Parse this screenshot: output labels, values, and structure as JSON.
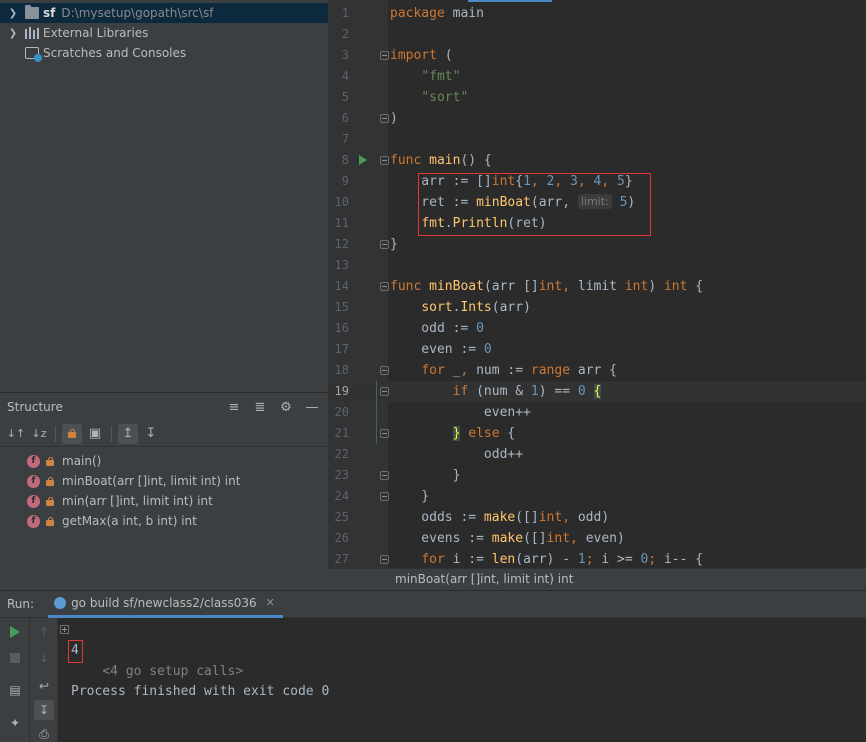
{
  "project": {
    "root": {
      "name": "sf",
      "path": "D:\\mysetup\\gopath\\src\\sf"
    },
    "items": [
      {
        "label": "External Libraries"
      },
      {
        "label": "Scratches and Consoles"
      }
    ]
  },
  "structure": {
    "title": "Structure",
    "members": [
      {
        "badge": "f",
        "label": "main()"
      },
      {
        "badge": "f",
        "label": "minBoat(arr []int, limit int) int"
      },
      {
        "badge": "f",
        "label": "min(arr []int, limit int) int"
      },
      {
        "badge": "f",
        "label": "getMax(a int, b int) int"
      }
    ]
  },
  "editor": {
    "current_line": 19,
    "lines": [
      {
        "n": "1",
        "tokens": [
          [
            "kw",
            "package"
          ],
          [
            "plain",
            " main"
          ]
        ]
      },
      {
        "n": "2",
        "tokens": []
      },
      {
        "n": "3",
        "fold": true,
        "tokens": [
          [
            "kw",
            "import"
          ],
          [
            "plain",
            " ("
          ]
        ]
      },
      {
        "n": "4",
        "tokens": [
          [
            "plain",
            "    "
          ],
          [
            "str",
            "\"fmt\""
          ]
        ]
      },
      {
        "n": "5",
        "tokens": [
          [
            "plain",
            "    "
          ],
          [
            "str",
            "\"sort\""
          ]
        ]
      },
      {
        "n": "6",
        "fold": true,
        "tokens": [
          [
            "plain",
            ")"
          ]
        ]
      },
      {
        "n": "7",
        "tokens": []
      },
      {
        "n": "8",
        "fold": true,
        "run": true,
        "tokens": [
          [
            "kw",
            "func"
          ],
          [
            "plain",
            " "
          ],
          [
            "fn",
            "main"
          ],
          [
            "plain",
            "() {"
          ]
        ]
      },
      {
        "n": "9",
        "tokens": [
          [
            "plain",
            "    arr := []"
          ],
          [
            "typ",
            "int"
          ],
          [
            "plain",
            "{"
          ],
          [
            "num",
            "1"
          ],
          [
            "kw",
            ", "
          ],
          [
            "num",
            "2"
          ],
          [
            "kw",
            ", "
          ],
          [
            "num",
            "3"
          ],
          [
            "kw",
            ", "
          ],
          [
            "num",
            "4"
          ],
          [
            "kw",
            ", "
          ],
          [
            "num",
            "5"
          ],
          [
            "plain",
            "}"
          ]
        ]
      },
      {
        "n": "10",
        "tokens": [
          [
            "plain",
            "    ret := "
          ],
          [
            "fn",
            "minBoat"
          ],
          [
            "plain",
            "(arr, "
          ],
          [
            "hint",
            "limit:"
          ],
          [
            "plain",
            " "
          ],
          [
            "num",
            "5"
          ],
          [
            "plain",
            ")"
          ]
        ]
      },
      {
        "n": "11",
        "tokens": [
          [
            "plain",
            "    "
          ],
          [
            "fn",
            "fmt"
          ],
          [
            "plain",
            "."
          ],
          [
            "fn",
            "Println"
          ],
          [
            "plain",
            "(ret)"
          ]
        ]
      },
      {
        "n": "12",
        "fold": true,
        "tokens": [
          [
            "plain",
            "}"
          ]
        ]
      },
      {
        "n": "13",
        "tokens": []
      },
      {
        "n": "14",
        "fold": true,
        "tokens": [
          [
            "kw",
            "func"
          ],
          [
            "plain",
            " "
          ],
          [
            "fn",
            "minBoat"
          ],
          [
            "plain",
            "(arr []"
          ],
          [
            "typ",
            "int"
          ],
          [
            "kw",
            ", "
          ],
          [
            "plain",
            "limit "
          ],
          [
            "typ",
            "int"
          ],
          [
            "plain",
            ") "
          ],
          [
            "typ",
            "int"
          ],
          [
            "plain",
            " {"
          ]
        ]
      },
      {
        "n": "15",
        "tokens": [
          [
            "plain",
            "    "
          ],
          [
            "fn",
            "sort"
          ],
          [
            "plain",
            "."
          ],
          [
            "fn",
            "Ints"
          ],
          [
            "plain",
            "(arr)"
          ]
        ]
      },
      {
        "n": "16",
        "tokens": [
          [
            "plain",
            "    odd := "
          ],
          [
            "num",
            "0"
          ]
        ]
      },
      {
        "n": "17",
        "tokens": [
          [
            "plain",
            "    even := "
          ],
          [
            "num",
            "0"
          ]
        ]
      },
      {
        "n": "18",
        "fold": true,
        "tokens": [
          [
            "plain",
            "    "
          ],
          [
            "kw",
            "for"
          ],
          [
            "plain",
            " _"
          ],
          [
            "kw",
            ", "
          ],
          [
            "plain",
            "num := "
          ],
          [
            "kw",
            "range"
          ],
          [
            "plain",
            " arr {"
          ]
        ]
      },
      {
        "n": "19",
        "fold": true,
        "tokens": [
          [
            "plain",
            "        "
          ],
          [
            "kw",
            "if"
          ],
          [
            "plain",
            " (num & "
          ],
          [
            "num",
            "1"
          ],
          [
            "plain",
            ") == "
          ],
          [
            "num",
            "0"
          ],
          [
            "plain",
            " "
          ],
          [
            "brace",
            "{"
          ]
        ]
      },
      {
        "n": "20",
        "tokens": [
          [
            "plain",
            "            even++"
          ]
        ]
      },
      {
        "n": "21",
        "fold": true,
        "tokens": [
          [
            "plain",
            "        "
          ],
          [
            "brace",
            "}"
          ],
          [
            "plain",
            " "
          ],
          [
            "kw",
            "else"
          ],
          [
            "plain",
            " {"
          ]
        ]
      },
      {
        "n": "22",
        "tokens": [
          [
            "plain",
            "            odd++"
          ]
        ]
      },
      {
        "n": "23",
        "fold": true,
        "tokens": [
          [
            "plain",
            "        }"
          ]
        ]
      },
      {
        "n": "24",
        "fold": true,
        "tokens": [
          [
            "plain",
            "    }"
          ]
        ]
      },
      {
        "n": "25",
        "tokens": [
          [
            "plain",
            "    odds := "
          ],
          [
            "fn",
            "make"
          ],
          [
            "plain",
            "([]"
          ],
          [
            "typ",
            "int"
          ],
          [
            "kw",
            ", "
          ],
          [
            "plain",
            "odd)"
          ]
        ]
      },
      {
        "n": "26",
        "tokens": [
          [
            "plain",
            "    evens := "
          ],
          [
            "fn",
            "make"
          ],
          [
            "plain",
            "([]"
          ],
          [
            "typ",
            "int"
          ],
          [
            "kw",
            ", "
          ],
          [
            "plain",
            "even)"
          ]
        ]
      },
      {
        "n": "27",
        "fold": true,
        "tokens": [
          [
            "plain",
            "    "
          ],
          [
            "kw",
            "for"
          ],
          [
            "plain",
            " i := "
          ],
          [
            "fn",
            "len"
          ],
          [
            "plain",
            "(arr) - "
          ],
          [
            "num",
            "1"
          ],
          [
            "kw",
            "; "
          ],
          [
            "plain",
            "i >= "
          ],
          [
            "num",
            "0"
          ],
          [
            "kw",
            "; "
          ],
          [
            "plain",
            "i-- {"
          ]
        ]
      }
    ]
  },
  "breadcrumb": "minBoat(arr []int, limit int) int",
  "run": {
    "label": "Run:",
    "tab": "go build sf/newclass2/class036",
    "console": {
      "collapsed": "<4 go setup calls>",
      "output": "4",
      "exit": "Process finished with exit code 0"
    }
  },
  "colors": {
    "keyword": "#cc7832",
    "string": "#6a8759",
    "function": "#ffc66d",
    "number": "#6897bb",
    "highlight_box": "#e03737"
  }
}
